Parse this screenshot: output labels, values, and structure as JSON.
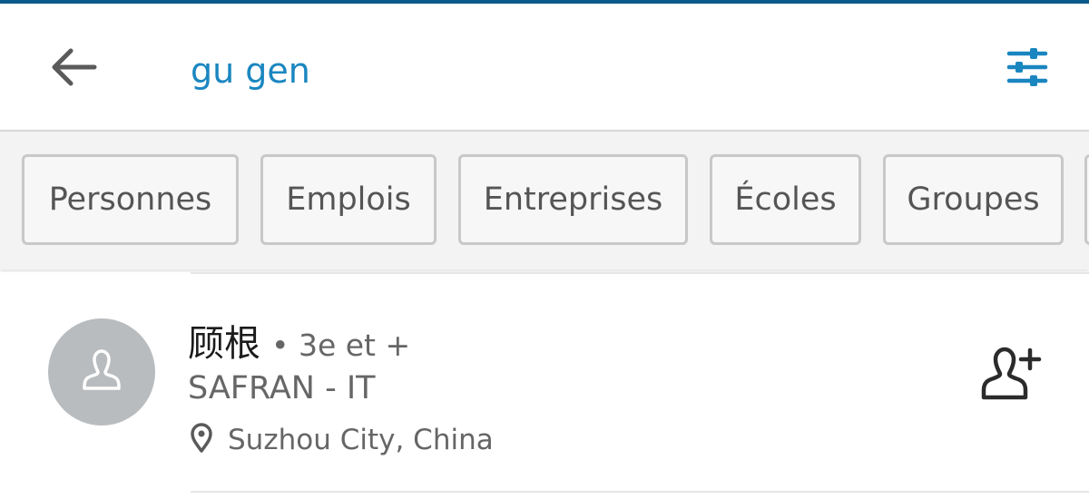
{
  "search": {
    "query": "gu gen"
  },
  "icons": {
    "back": "arrow-left-icon",
    "filter": "sliders-icon",
    "avatar": "person-placeholder-icon",
    "location": "map-pin-icon",
    "connect": "add-person-icon"
  },
  "colors": {
    "accent": "#1a86c0",
    "top_line": "#0a5a8c",
    "tab_bar_bg": "#f3f3f3",
    "avatar_bg": "#b9bcbf"
  },
  "tabs": [
    {
      "label": "Personnes"
    },
    {
      "label": "Emplois"
    },
    {
      "label": "Entreprises"
    },
    {
      "label": "Écoles"
    },
    {
      "label": "Groupes"
    }
  ],
  "results": [
    {
      "name": "顾根",
      "degree": "• 3e et +",
      "headline": "SAFRAN - IT",
      "location": "Suzhou City, China"
    }
  ]
}
